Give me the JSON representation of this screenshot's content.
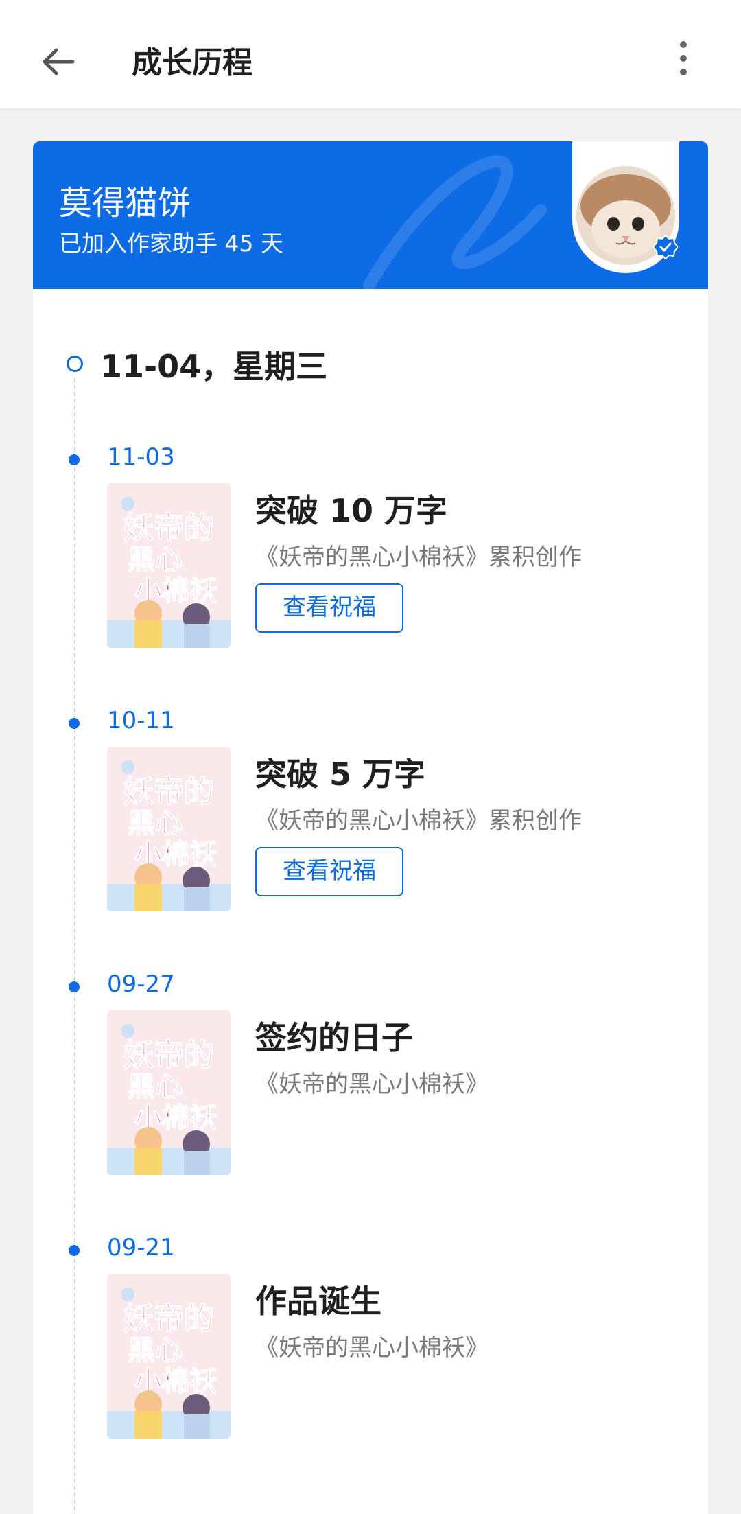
{
  "header": {
    "title": "成长历程",
    "back_icon": "arrow-left-icon",
    "more_icon": "more-vertical-icon"
  },
  "profile": {
    "name": "莫得猫饼",
    "joined_text": "已加入作家助手 45 天",
    "avatar": "cat-avatar",
    "badge_icon": "verified-badge-icon"
  },
  "timeline": {
    "today_label": "11-04，星期三",
    "entries": [
      {
        "date": "11-03",
        "title": "突破 10 万字",
        "subtitle": "《妖帝的黑心小棉袄》累积创作",
        "button": "查看祝福"
      },
      {
        "date": "10-11",
        "title": "突破 5 万字",
        "subtitle": "《妖帝的黑心小棉袄》累积创作",
        "button": "查看祝福"
      },
      {
        "date": "09-27",
        "title": "签约的日子",
        "subtitle": "《妖帝的黑心小棉袄》"
      },
      {
        "date": "09-21",
        "title": "作品诞生",
        "subtitle": "《妖帝的黑心小棉袄》"
      }
    ]
  },
  "colors": {
    "accent": "#0d6be5",
    "banner": "#0d6be5",
    "background": "#f2f2f2",
    "muted_text": "#7a7a7a"
  }
}
